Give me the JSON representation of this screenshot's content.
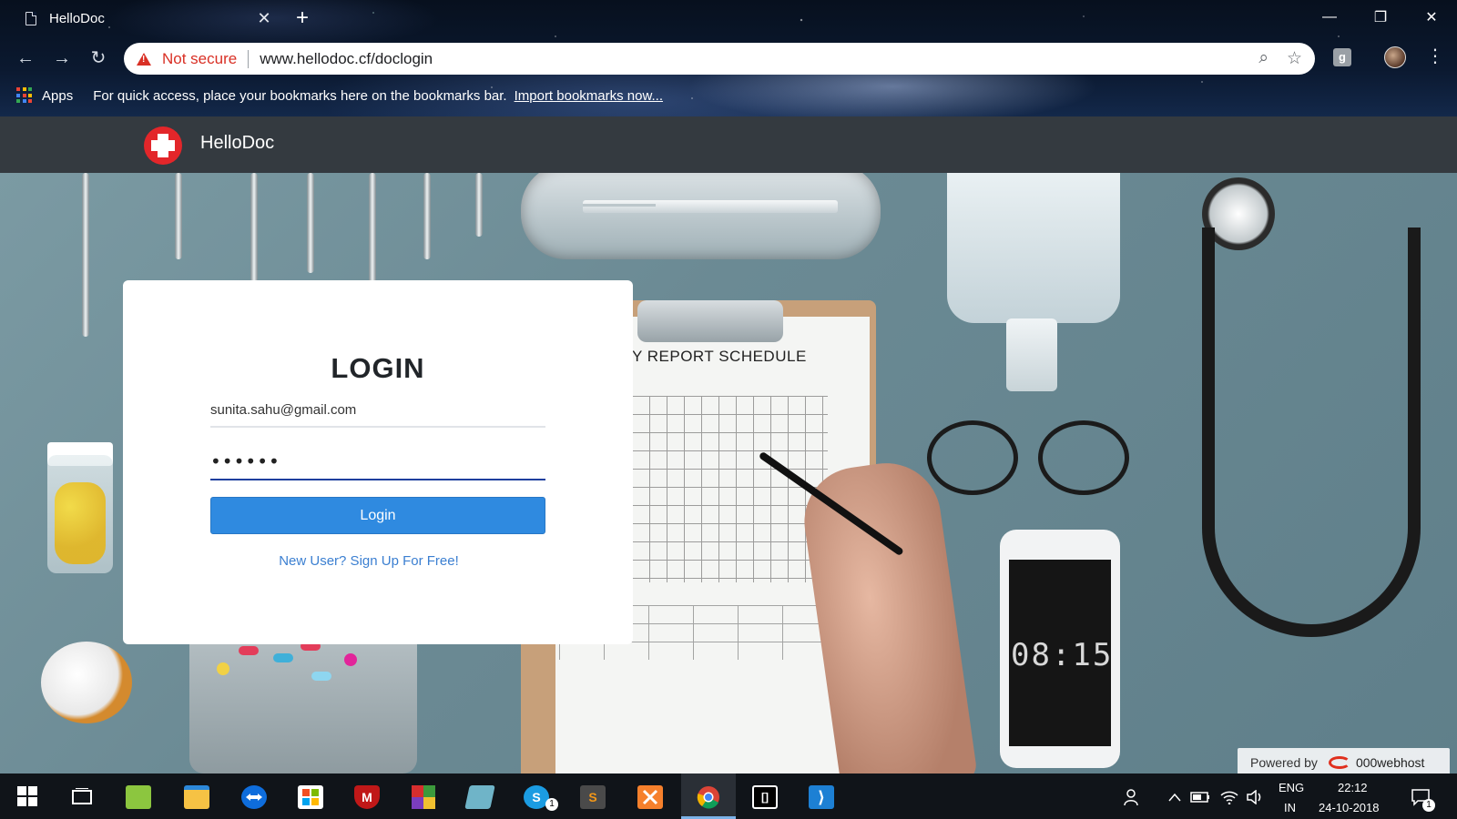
{
  "browser": {
    "tab_title": "HelloDoc",
    "tab_close": "✕",
    "new_tab": "+",
    "window_controls": {
      "minimize": "—",
      "restore": "❐",
      "close": "✕"
    },
    "nav": {
      "back": "←",
      "forward": "→",
      "reload": "↻"
    },
    "omnibox": {
      "security_label": "Not secure",
      "url": "www.hellodoc.cf/doclogin",
      "zoom_icon": "⌕",
      "star_icon": "☆"
    },
    "extension_label": "g",
    "menu": "⋮",
    "bookmarks_bar": {
      "apps_label": "Apps",
      "hint": "For quick access, place your bookmarks here on the bookmarks bar.",
      "import_link": "Import bookmarks now..."
    }
  },
  "site": {
    "brand": "HelloDoc",
    "brand_color": "#e3262a",
    "header_bg": "#343a40"
  },
  "hero": {
    "schedule_title": "Y REPORT SCHEDULE",
    "phone_clock": "08:15"
  },
  "login": {
    "title": "LOGIN",
    "email_value": "sunita.sahu@gmail.com",
    "password_value": "••••••",
    "button_label": "Login",
    "signup_link": "New User? Sign Up For Free!",
    "button_color": "#2f8ae0",
    "link_color": "#3b7fd1"
  },
  "powered_by": {
    "label": "Powered by",
    "host": "000webhost"
  },
  "taskbar": {
    "apps": [
      {
        "name": "start",
        "icon": "windows-icon"
      },
      {
        "name": "task-view",
        "icon": "task-view-icon"
      },
      {
        "name": "notepad",
        "icon": "notepad-icon"
      },
      {
        "name": "file-explorer",
        "icon": "folder-icon"
      },
      {
        "name": "teamviewer",
        "icon": "teamviewer-icon"
      },
      {
        "name": "store",
        "icon": "store-icon"
      },
      {
        "name": "mcafee",
        "icon": "mcafee-icon",
        "label": "M"
      },
      {
        "name": "winrar",
        "icon": "winrar-icon"
      },
      {
        "name": "notepad-app",
        "icon": "pad-icon"
      },
      {
        "name": "skype",
        "icon": "skype-icon",
        "label": "S",
        "badge": "1"
      },
      {
        "name": "sublime",
        "icon": "sublime-icon",
        "label": "S"
      },
      {
        "name": "xampp",
        "icon": "xampp-icon"
      },
      {
        "name": "chrome",
        "icon": "chrome-icon"
      },
      {
        "name": "intellij",
        "icon": "intellij-icon",
        "label": "[]"
      },
      {
        "name": "vscode",
        "icon": "vscode-icon",
        "label": "⟩"
      }
    ],
    "tray": {
      "language_top": "ENG",
      "language_bottom": "IN",
      "time": "22:12",
      "date": "24-10-2018",
      "notification_badge": "1"
    }
  }
}
